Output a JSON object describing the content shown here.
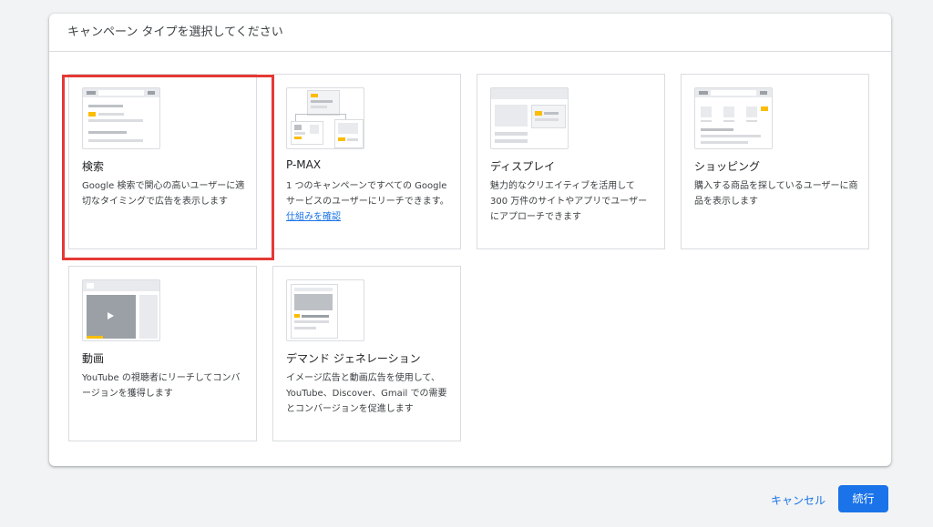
{
  "dialog": {
    "title": "キャンペーン タイプを選択してください"
  },
  "cards": [
    {
      "title": "検索",
      "desc": "Google 検索で関心の高いユーザーに適切なタイミングで広告を表示します",
      "icon": "search-campaign-icon"
    },
    {
      "title": "P-MAX",
      "desc": "1 つのキャンペーンですべての Google サービスのユーザーにリーチできます。",
      "link": "仕組みを確認",
      "icon": "pmax-campaign-icon"
    },
    {
      "title": "ディスプレイ",
      "desc": "魅力的なクリエイティブを活用して 300 万件のサイトやアプリでユーザーにアプローチできます",
      "icon": "display-campaign-icon"
    },
    {
      "title": "ショッピング",
      "desc": "購入する商品を探しているユーザーに商品を表示します",
      "icon": "shopping-campaign-icon"
    },
    {
      "title": "動画",
      "desc": "YouTube の視聴者にリーチしてコンバージョンを獲得します",
      "icon": "video-campaign-icon"
    },
    {
      "title": "デマンド ジェネレーション",
      "desc": "イメージ広告と動画広告を使用して、YouTube、Discover、Gmail での需要とコンバージョンを促進します",
      "icon": "demand-gen-campaign-icon"
    }
  ],
  "buttons": {
    "cancel": "キャンセル",
    "continue": "続行"
  },
  "colors": {
    "accent": "#1a73e8",
    "highlight": "#e53935",
    "thumb_accent": "#fbbc04"
  }
}
